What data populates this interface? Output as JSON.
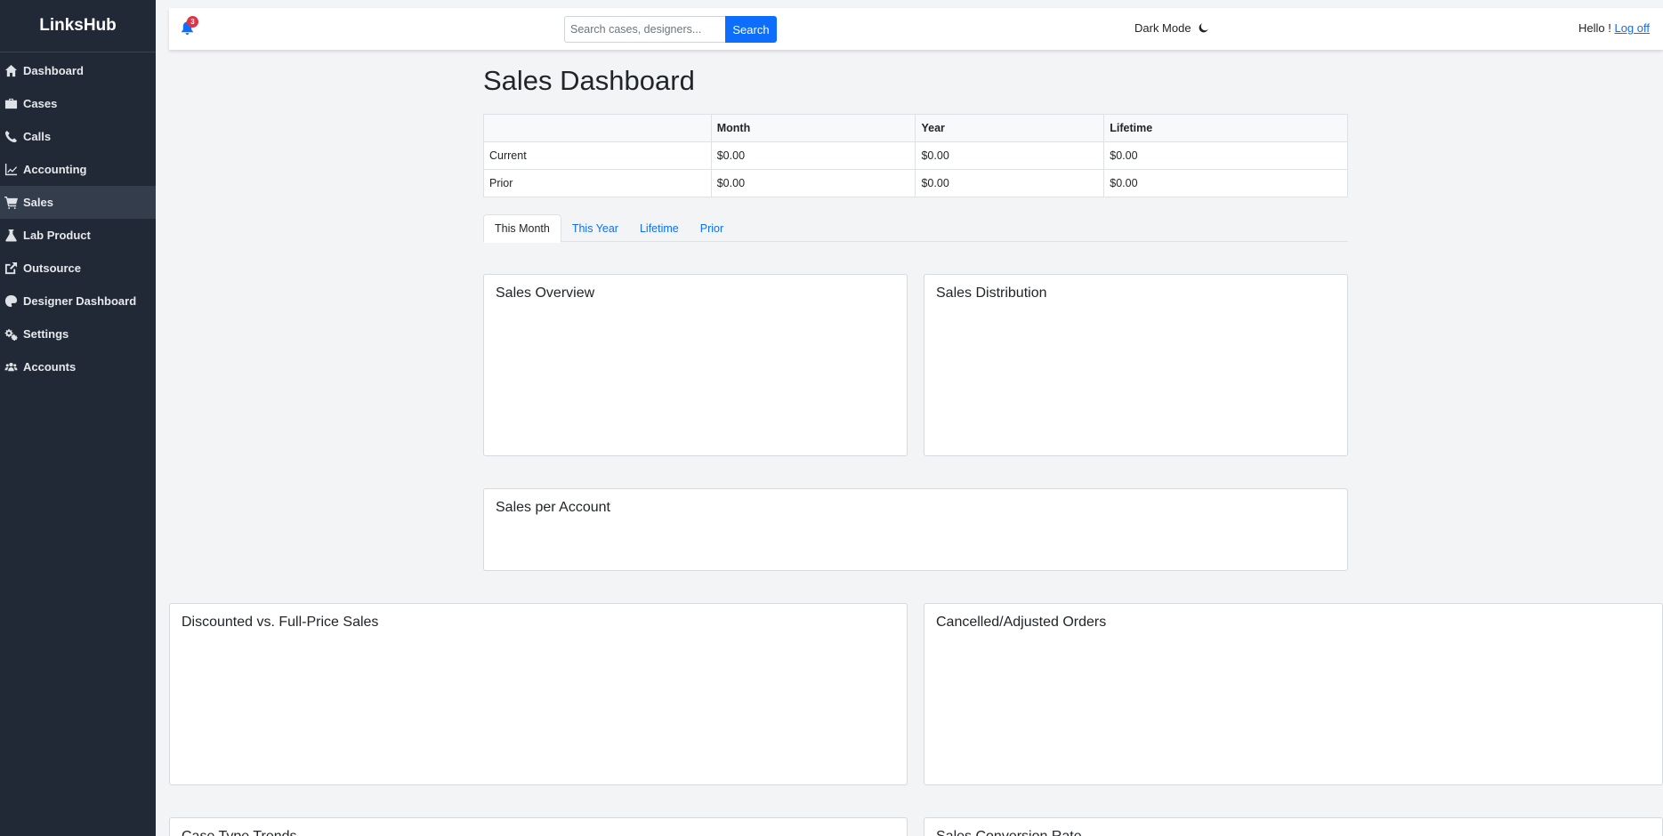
{
  "sidebar": {
    "brand": "LinksHub",
    "items": [
      {
        "label": "Dashboard",
        "icon": "home-icon"
      },
      {
        "label": "Cases",
        "icon": "briefcase-icon"
      },
      {
        "label": "Calls",
        "icon": "phone-icon"
      },
      {
        "label": "Accounting",
        "icon": "chart-line-icon"
      },
      {
        "label": "Sales",
        "icon": "cart-icon",
        "active": true
      },
      {
        "label": "Lab Product",
        "icon": "flask-icon"
      },
      {
        "label": "Outsource",
        "icon": "external-link-icon"
      },
      {
        "label": "Designer Dashboard",
        "icon": "palette-icon"
      },
      {
        "label": "Settings",
        "icon": "gears-icon"
      },
      {
        "label": "Accounts",
        "icon": "users-icon"
      }
    ]
  },
  "topbar": {
    "notification_count": "3",
    "search_placeholder": "Search cases, designers...",
    "search_button": "Search",
    "dark_mode_label": "Dark Mode",
    "greeting": "Hello !",
    "logoff_label": "Log off"
  },
  "main": {
    "title": "Sales Dashboard",
    "summary_table": {
      "headers": [
        "",
        "Month",
        "Year",
        "Lifetime"
      ],
      "rows": [
        [
          "Current",
          "$0.00",
          "$0.00",
          "$0.00"
        ],
        [
          "Prior",
          "$0.00",
          "$0.00",
          "$0.00"
        ]
      ]
    },
    "tabs": [
      "This Month",
      "This Year",
      "Lifetime",
      "Prior"
    ],
    "active_tab": "This Month",
    "cards": [
      "Sales Overview",
      "Sales Distribution",
      "Sales per Account",
      "Discounted vs. Full-Price Sales",
      "Cancelled/Adjusted Orders",
      "Case Type Trends",
      "Sales Conversion Rate"
    ]
  },
  "colors": {
    "sidebar_bg": "#212936",
    "accent": "#0d6efd",
    "badge": "#dc3545"
  }
}
